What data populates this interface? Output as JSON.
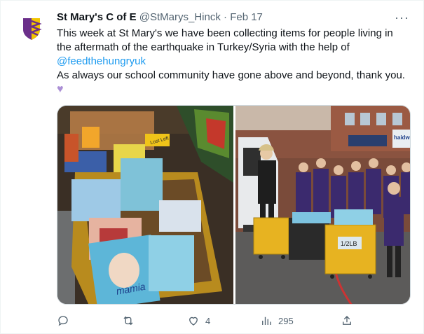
{
  "tweet": {
    "author_name": "St Mary's C of E",
    "handle": "@StMarys_Hinck",
    "separator": "·",
    "date": "Feb 17",
    "more_label": "···",
    "text_line1": "This week at St Mary's we have been collecting items for people living in the aftermath of the earthquake in Turkey/Syria with the help of",
    "mention": "@feedthehungryuk",
    "text_line2": "As always our school community have gone above and beyond, thank you.",
    "emoji": "♥"
  },
  "media": {
    "left_image": "donated-items-bin-photo",
    "right_image": "school-children-with-bins-photo",
    "bin_sign": "Lost Left",
    "bin_label": "1/2LB",
    "pack_brand": "mamia",
    "storefront": "haidw"
  },
  "actions": {
    "reply_count": "",
    "retweet_count": "",
    "like_count": "4",
    "views_count": "295"
  },
  "colors": {
    "accent": "#1d9bf0",
    "muted": "#536471",
    "avatar_purple": "#6b2f8a",
    "avatar_yellow": "#f2c500"
  },
  "icons": [
    "shield-logo-icon",
    "more-icon",
    "reply-icon",
    "retweet-icon",
    "like-icon",
    "views-icon",
    "share-icon"
  ]
}
